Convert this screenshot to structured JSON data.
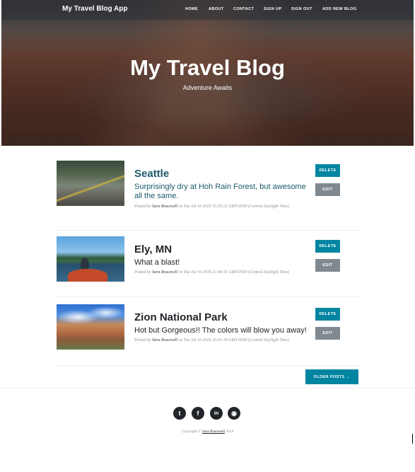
{
  "navbar": {
    "brand": "My Travel Blog App",
    "links": [
      "HOME",
      "ABOUT",
      "CONTACT",
      "SIGN UP",
      "SIGN OUT",
      "ADD NEW BLOG"
    ]
  },
  "hero": {
    "title": "My Travel Blog",
    "subtitle": "Adventure Awaits"
  },
  "posts": [
    {
      "title": "Seattle",
      "subtitle": "Surprisingly dry at Hoh Rain Forest, but awesome all the same.",
      "posted_by": "Posted by",
      "author": "Sara Bracevell",
      "date": "on Tue Jul 10 2018 15:20:32 GMT-0500 (Central Daylight Time)",
      "title_color": "#1a5a6a"
    },
    {
      "title": "Ely, MN",
      "subtitle": "What a blast!",
      "posted_by": "Posted by",
      "author": "Sara Bracevell",
      "date": "on Tue Jul 10 2018 22:46:31 GMT-0500 (Central Daylight Time)",
      "title_color": "#212529"
    },
    {
      "title": "Zion National Park",
      "subtitle": "Hot but Gorgeous!! The colors will blow you away!",
      "posted_by": "Posted by",
      "author": "Sara Bracevell",
      "date": "on Tue Jul 10 2018 23:01:39 GMT-0500 (Central Daylight Time)",
      "title_color": "#212529"
    }
  ],
  "buttons": {
    "delete": "DELETE",
    "edit": "EDIT",
    "older_posts": "OLDER POSTS →"
  },
  "footer": {
    "social_icons": [
      "twitter-icon",
      "facebook-icon",
      "linkedin-icon",
      "github-icon"
    ],
    "social_glyphs": [
      "t",
      "f",
      "in",
      "◉"
    ],
    "copyright_prefix": "Copyright ©",
    "copyright_name": "Sara Bracevell",
    "copyright_year": "2018"
  },
  "colors": {
    "accent": "#0085a1",
    "edit_button": "#808890",
    "text": "#212529",
    "meta": "#868e96"
  }
}
